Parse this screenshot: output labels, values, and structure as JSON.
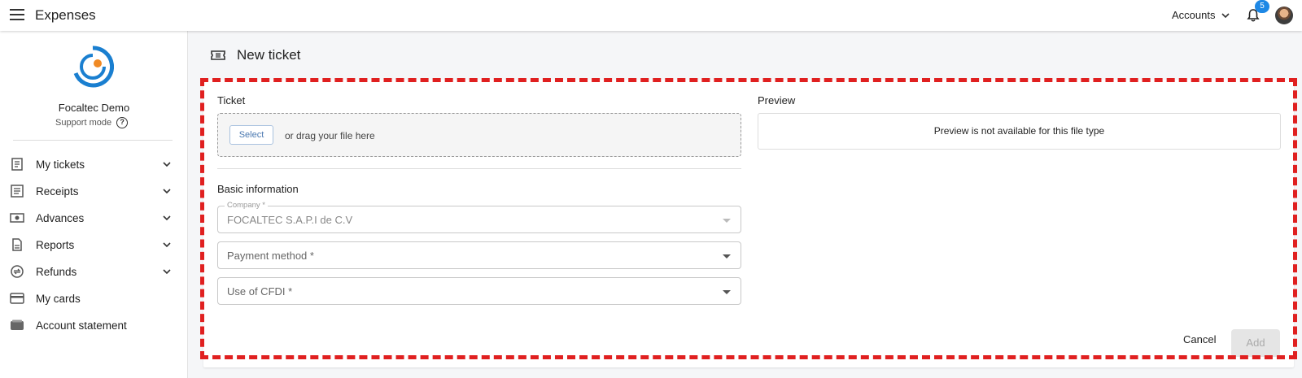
{
  "header": {
    "app_title": "Expenses",
    "accounts_label": "Accounts",
    "notifications_count": "5"
  },
  "sidebar": {
    "org_name": "Focaltec Demo",
    "support_mode": "Support mode",
    "items": [
      {
        "label": "My tickets",
        "icon": "receipt-icon",
        "expandable": true
      },
      {
        "label": "Receipts",
        "icon": "document-list-icon",
        "expandable": true
      },
      {
        "label": "Advances",
        "icon": "cash-icon",
        "expandable": true
      },
      {
        "label": "Reports",
        "icon": "report-icon",
        "expandable": true
      },
      {
        "label": "Refunds",
        "icon": "exchange-icon",
        "expandable": true
      },
      {
        "label": "My cards",
        "icon": "credit-card-icon",
        "expandable": false
      },
      {
        "label": "Account statement",
        "icon": "wallet-icon",
        "expandable": false
      }
    ]
  },
  "page": {
    "title": "New ticket",
    "ticket_section": "Ticket",
    "select_button": "Select",
    "drop_hint": "or drag your file here",
    "basic_info": "Basic information",
    "company_label": "Company *",
    "company_value": "FOCALTEC S.A.P.I de C.V",
    "payment_method_placeholder": "Payment method *",
    "cfdi_placeholder": "Use of CFDI *",
    "preview_section": "Preview",
    "preview_message": "Preview is not available for this file type",
    "cancel_button": "Cancel",
    "add_button": "Add"
  },
  "colors": {
    "accent": "#1e88e5",
    "annotation_dashed_border": "#e02020",
    "logo_blue": "#1a7fd0",
    "logo_orange": "#f08a24"
  }
}
